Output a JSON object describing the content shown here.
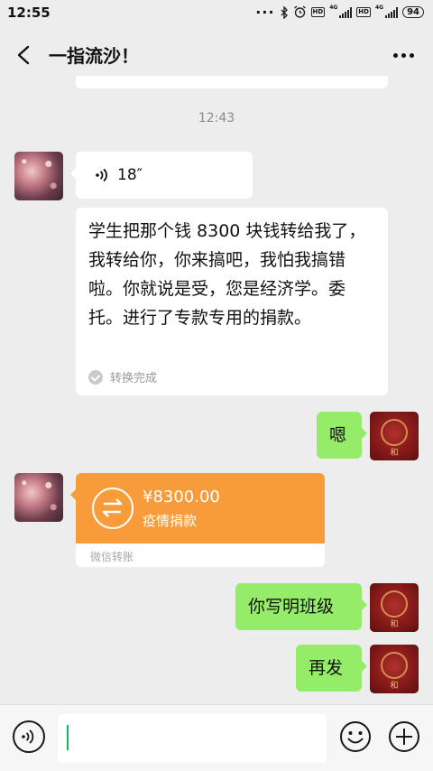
{
  "status_bar": {
    "time": "12:55",
    "network_label": "4G",
    "hd_label": "HD",
    "battery": "94"
  },
  "header": {
    "title": "一指流沙！"
  },
  "timestamp": "12:43",
  "messages": {
    "voice": {
      "duration": "18″"
    },
    "transcript": {
      "text": "学生把那个钱 8300 块钱转给我了，我转给你，你来搞吧，我怕我搞错啦。你就说是受，您是经济学。委托。进行了专款专用的捐款。",
      "status": "转换完成"
    },
    "out_1": "嗯",
    "transfer": {
      "amount": "¥8300.00",
      "note": "疫情捐款",
      "footer": "微信转账"
    },
    "out_2": "你写明班级",
    "out_3": "再发"
  },
  "avatar_me_glyph": "和",
  "colors": {
    "accent_green": "#95ec69",
    "transfer_orange": "#f89c3b",
    "caret_green": "#07c160"
  }
}
